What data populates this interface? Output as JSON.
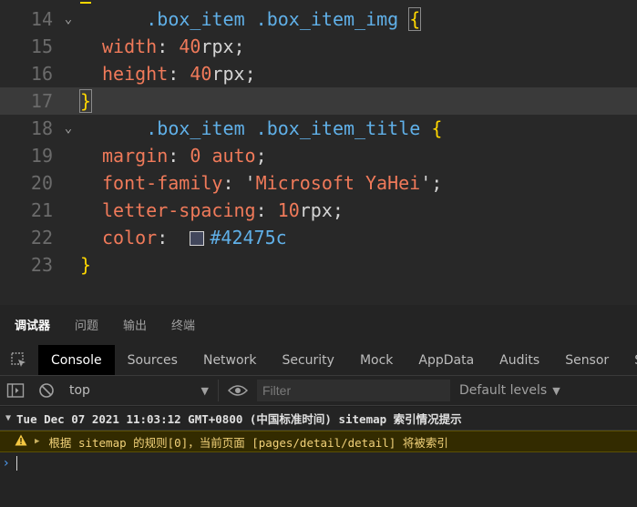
{
  "editor": {
    "lines": [
      {
        "num": "14",
        "fold": true,
        "selector": ".box_item .box_item_img",
        "open": "{"
      },
      {
        "num": "15",
        "prop": "width",
        "value_num": "40",
        "unit": "rpx"
      },
      {
        "num": "16",
        "prop": "height",
        "value_num": "40",
        "unit": "rpx"
      },
      {
        "num": "17",
        "close": "}"
      },
      {
        "num": "18",
        "fold": true,
        "selector": ".box_item .box_item_title",
        "open": "{"
      },
      {
        "num": "19",
        "prop": "margin",
        "value_num": "0",
        "value_kw": "auto"
      },
      {
        "num": "20",
        "prop": "font-family",
        "value_str": "Microsoft YaHei"
      },
      {
        "num": "21",
        "prop": "letter-spacing",
        "value_num": "10",
        "unit": "rpx"
      },
      {
        "num": "22",
        "prop": "color",
        "value_color": "#42475c"
      },
      {
        "num": "23",
        "close": "}"
      }
    ]
  },
  "panel_tabs": [
    "调试器",
    "问题",
    "输出",
    "终端"
  ],
  "devtools_tabs": [
    "Console",
    "Sources",
    "Network",
    "Security",
    "Mock",
    "AppData",
    "Audits",
    "Sensor",
    "St"
  ],
  "toolbar": {
    "context": "top",
    "filter_placeholder": "Filter",
    "levels": "Default levels"
  },
  "console": {
    "group_title": "Tue Dec 07 2021 11:03:12 GMT+0800 (中国标准时间) sitemap 索引情况提示",
    "warning": "根据 sitemap 的规则[0]，当前页面 [pages/detail/detail] 将被索引"
  },
  "colors": {
    "swatch": "#42475c",
    "active_tab_bg": "#000000",
    "warning_bg": "#332b00",
    "warning_text": "#f2d27a"
  }
}
